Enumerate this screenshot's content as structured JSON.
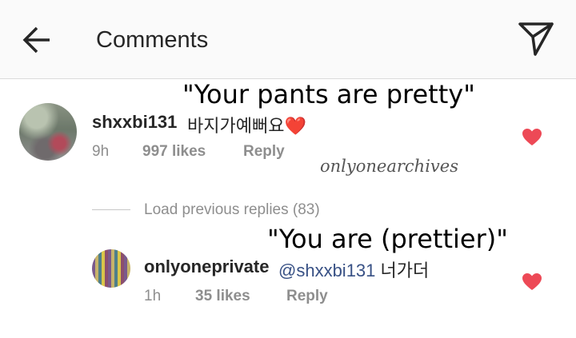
{
  "header": {
    "title": "Comments",
    "back_icon": "arrow-left-icon",
    "send_icon": "paper-plane-icon"
  },
  "overlays": {
    "translation_1": "\"Your pants are pretty\"",
    "translation_2": "\"You are (prettier)\"",
    "watermark": "onlyonearchives"
  },
  "comment": {
    "username": "shxxbi131",
    "text": "바지가예뻐요",
    "emoji": "❤️",
    "time": "9h",
    "likes": "997 likes",
    "reply_label": "Reply"
  },
  "load_previous": "Load previous replies (83)",
  "reply": {
    "username": "onlyoneprivate",
    "mention": "@shxxbi131",
    "text": "너가더",
    "time": "1h",
    "likes": "35 likes",
    "reply_label": "Reply"
  },
  "colors": {
    "heart": "#ed4956",
    "text": "#262626",
    "meta": "#8e8e8e",
    "mention": "#385185",
    "header_bg": "#fafafa"
  }
}
